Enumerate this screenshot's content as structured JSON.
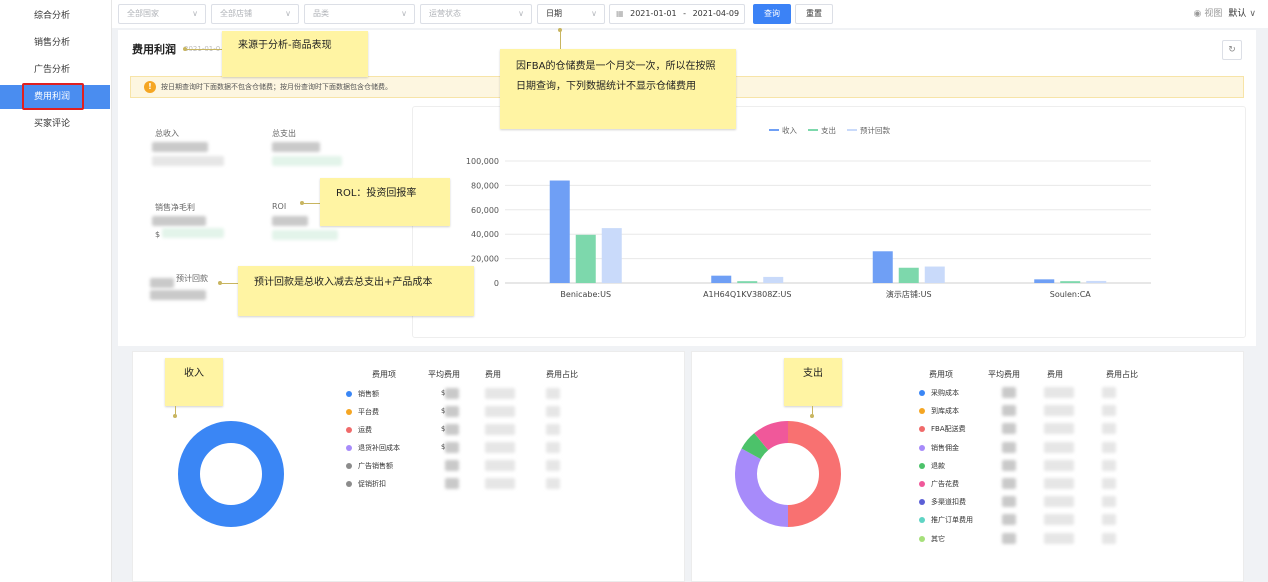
{
  "sidebar": {
    "items": [
      {
        "label": "综合分析"
      },
      {
        "label": "销售分析"
      },
      {
        "label": "广告分析"
      },
      {
        "label": "费用利润"
      },
      {
        "label": "买家评论"
      }
    ]
  },
  "filters": {
    "country_placeholder": "全部国家",
    "store_placeholder": "全部店铺",
    "product_placeholder": "品类",
    "status_placeholder": "运营状态",
    "date_type": "日期",
    "date_start": "2021-01-01",
    "date_sep": "-",
    "date_end": "2021-04-09",
    "query_label": "查询",
    "reset_label": "重置",
    "view_label": "视图",
    "default_label": "默认"
  },
  "page": {
    "title": "费用利润",
    "date": "2021-01-0",
    "notice": "按日期查询时下面数据不包含仓储费；按月份查询时下面数据包含仓储费。"
  },
  "kpis": {
    "total_income_label": "总收入",
    "total_expense_label": "总支出",
    "net_margin_label": "销售净毛利",
    "roi_label": "ROI",
    "payback_label": "预计回款",
    "net_margin_value_prefix": "$"
  },
  "chart_data": {
    "type": "bar",
    "categories": [
      "Benicabe:US",
      "A1H64Q1KV3808Z:US",
      "演示店铺:US",
      "Soulen:CA"
    ],
    "series": [
      {
        "name": "收入",
        "color": "#6f9ff5",
        "values": [
          84000,
          6000,
          26000,
          3000
        ]
      },
      {
        "name": "支出",
        "color": "#7dd8ac",
        "values": [
          39500,
          1500,
          12500,
          1500
        ]
      },
      {
        "name": "预计回款",
        "color": "#c9dafa",
        "values": [
          45000,
          5000,
          13500,
          1700
        ]
      }
    ],
    "yticks": [
      "0",
      "20,000",
      "40,000",
      "60,000",
      "80,000",
      "100,000"
    ],
    "ylim": [
      0,
      100000
    ],
    "legend": "top-center",
    "grid": true
  },
  "income_table": {
    "headers": [
      "费用项",
      "平均费用",
      "费用",
      "费用占比"
    ],
    "rows": [
      {
        "name": "销售额",
        "color": "#3a86f5",
        "avg": "$"
      },
      {
        "name": "平台费",
        "color": "#f5a623",
        "avg": "$"
      },
      {
        "name": "运费",
        "color": "#f06a6a",
        "avg": "$"
      },
      {
        "name": "退货补回成本",
        "color": "#a78bfa",
        "avg": "$"
      },
      {
        "name": "广告销售额",
        "color": "#8c8c8c",
        "avg": ""
      },
      {
        "name": "促销折扣",
        "color": "#8c8c8c",
        "avg": ""
      }
    ],
    "donut": [
      {
        "color": "#3a86f5",
        "value": 1
      }
    ]
  },
  "expense_table": {
    "headers": [
      "费用项",
      "平均费用",
      "费用",
      "费用占比"
    ],
    "rows": [
      {
        "name": "采购成本",
        "color": "#3a86f5"
      },
      {
        "name": "到库成本",
        "color": "#f5a623"
      },
      {
        "name": "FBA配送费",
        "color": "#f06a6a"
      },
      {
        "name": "销售佣金",
        "color": "#a78bfa"
      },
      {
        "name": "退款",
        "color": "#4cc26a"
      },
      {
        "name": "广告花费",
        "color": "#f0589a"
      },
      {
        "name": "多渠道扣费",
        "color": "#5b5fd6"
      },
      {
        "name": "推广订单费用",
        "color": "#5fd4c4"
      },
      {
        "name": "其它",
        "color": "#a6e07a"
      }
    ],
    "donut": [
      {
        "color": "#f87171",
        "value": 0.5
      },
      {
        "color": "#a78bfa",
        "value": 0.33
      },
      {
        "color": "#4cc26a",
        "value": 0.06
      },
      {
        "color": "#f0589a",
        "value": 0.11
      }
    ]
  },
  "annotations": {
    "source": "来源于分析-商品表现",
    "fba_note": "因FBA的仓储费是一个月交一次，所以在按照日期查询，下列数据统计不显示仓储费用",
    "roi_note": "ROL：投资回报率",
    "payback_note": "预计回款是总收入减去总支出+产品成本",
    "income_tag": "收入",
    "expense_tag": "支出"
  }
}
